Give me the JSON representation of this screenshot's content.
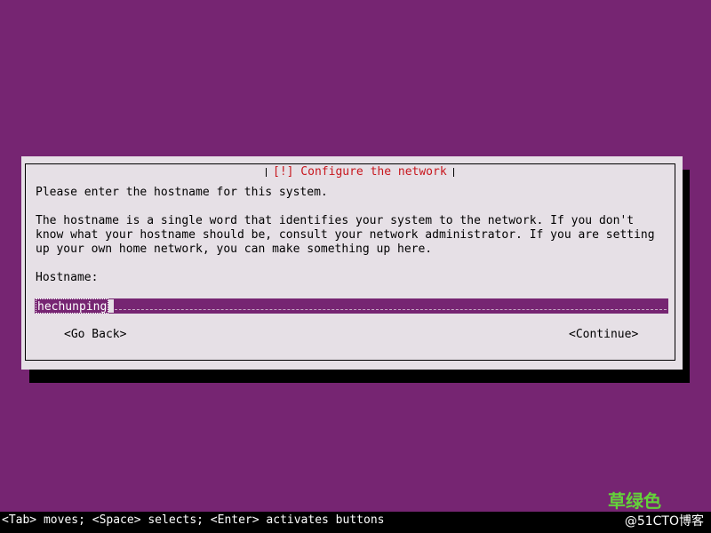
{
  "colors": {
    "background": "#762572",
    "dialog_bg": "#e6e0e6",
    "title_red": "#c8161d",
    "field_bg": "#762572",
    "status_bar_bg": "#000000",
    "watermark_green": "#64d23a"
  },
  "dialog": {
    "title": "[!] Configure the network",
    "prompt": "Please enter the hostname for this system.",
    "description": "The hostname is a single word that identifies your system to the network. If you don't\nknow what your hostname should be, consult your network administrator. If you are setting\nup your own home network, you can make something up here.",
    "hostname_label": "Hostname:",
    "hostname_value": "hechunping",
    "go_back_label": "<Go Back>",
    "continue_label": "<Continue>"
  },
  "status_bar": {
    "text": "<Tab> moves; <Space> selects; <Enter> activates buttons"
  },
  "watermark": {
    "top": "草绿色",
    "bottom": "@51CTO博客"
  }
}
